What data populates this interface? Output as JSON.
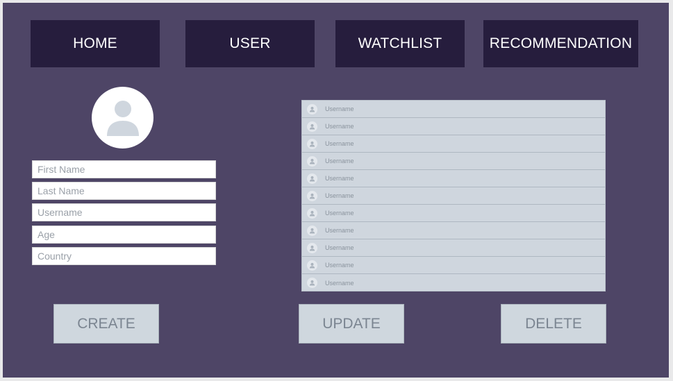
{
  "nav": {
    "home": "HOME",
    "user": "USER",
    "watchlist": "WATCHLIST",
    "recommendation": "RECOMMENDATION"
  },
  "form": {
    "first_name_placeholder": "First Name",
    "last_name_placeholder": "Last Name",
    "username_placeholder": "Username",
    "age_placeholder": "Age",
    "country_placeholder": "Country"
  },
  "user_list": {
    "items": [
      "Username",
      "Username",
      "Username",
      "Username",
      "Username",
      "Username",
      "Username",
      "Username",
      "Username",
      "Username",
      "Username"
    ]
  },
  "actions": {
    "create": "CREATE",
    "update": "UPDATE",
    "delete": "DELETE"
  },
  "icons": {
    "avatar": "user-avatar-icon",
    "list_avatar": "user-avatar-icon"
  },
  "colors": {
    "background": "#4e4566",
    "nav_button": "#261d3d",
    "action_button": "#cfd7de",
    "list_background": "#cfd6de"
  }
}
